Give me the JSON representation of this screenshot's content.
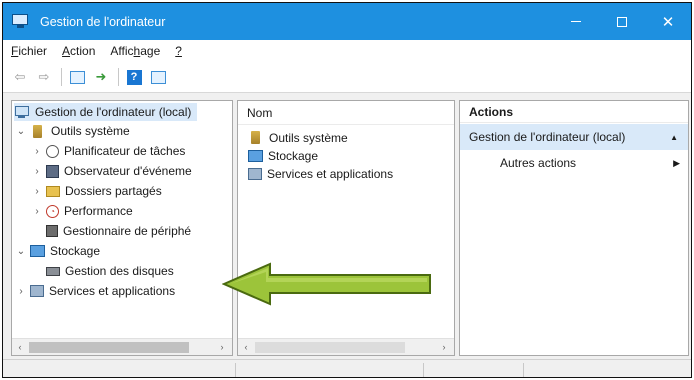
{
  "window": {
    "title": "Gestion de l'ordinateur",
    "minimize_glyph": "",
    "maximize_glyph": "",
    "close_glyph": "✕"
  },
  "menubar": {
    "items": [
      {
        "accel": "F",
        "rest": "ichier"
      },
      {
        "accel": "A",
        "rest": "ction"
      },
      {
        "pre": "Affic",
        "accel": "h",
        "rest": "age"
      },
      {
        "accel": "?",
        "rest": ""
      }
    ]
  },
  "toolbar": {
    "icons": [
      "back-arrow-icon",
      "forward-arrow-icon",
      "show-hide-tree-icon",
      "export-list-icon",
      "help-icon",
      "show-hide-action-pane-icon"
    ]
  },
  "tree": {
    "items": [
      {
        "label": "Gestion de l'ordinateur (local)",
        "expander": "",
        "icon": "computer-icon",
        "selected": true
      },
      {
        "label": "Outils système",
        "expander": "⌄",
        "icon": "tools-icon"
      },
      {
        "label": "Planificateur de tâches",
        "expander": "›",
        "icon": "clock-icon"
      },
      {
        "label": "Observateur d'événeme",
        "expander": "›",
        "icon": "event-viewer-icon"
      },
      {
        "label": "Dossiers partagés",
        "expander": "›",
        "icon": "shared-folder-icon"
      },
      {
        "label": "Performance",
        "expander": "›",
        "icon": "performance-icon"
      },
      {
        "label": "Gestionnaire de périphé",
        "expander": "",
        "icon": "device-manager-icon"
      },
      {
        "label": "Stockage",
        "expander": "⌄",
        "icon": "storage-icon"
      },
      {
        "label": "Gestion des disques",
        "expander": "",
        "icon": "disk-icon"
      },
      {
        "label": "Services et applications",
        "expander": "›",
        "icon": "services-icon"
      }
    ],
    "scroll_left": "‹",
    "scroll_right": "›"
  },
  "list": {
    "header": "Nom",
    "items": [
      {
        "label": "Outils système",
        "icon": "tools-icon"
      },
      {
        "label": "Stockage",
        "icon": "storage-icon"
      },
      {
        "label": "Services et applications",
        "icon": "services-icon"
      }
    ],
    "scroll_left": "‹",
    "scroll_right": "›"
  },
  "actions": {
    "header": "Actions",
    "group": "Gestion de l'ordinateur (local)",
    "group_glyph": "▲",
    "items": [
      {
        "label": "Autres actions",
        "glyph": "▶"
      }
    ]
  },
  "colors": {
    "titlebar": "#1e90e0",
    "selection": "#d9e9f9",
    "annotation_arrow": "#8cb82e"
  }
}
